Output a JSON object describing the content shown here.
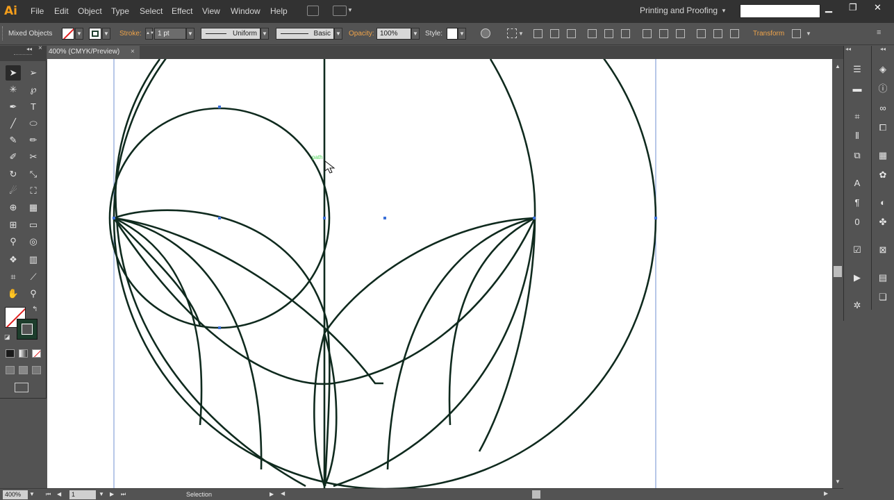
{
  "app": {
    "logo": "Ai"
  },
  "menu": {
    "items": [
      "File",
      "Edit",
      "Object",
      "Type",
      "Select",
      "Effect",
      "View",
      "Window",
      "Help"
    ],
    "workspace": "Printing and Proofing",
    "search_value": ""
  },
  "control_bar": {
    "selection_type": "Mixed Objects",
    "stroke_label": "Stroke:",
    "stroke_weight": "1 pt",
    "profile": "Uniform",
    "brush": "Basic",
    "opacity_label": "Opacity:",
    "opacity": "100%",
    "style_label": "Style:",
    "transform_label": "Transform"
  },
  "document": {
    "tab_title": "400% (CMYK/Preview)",
    "tab_close": "×",
    "hover_hint": "path"
  },
  "status_bar": {
    "zoom": "400%",
    "artboard": "1",
    "tool_name": "Selection"
  },
  "colors": {
    "stroke": "#0f2a1e",
    "selection": "#3a6fd8",
    "guide": "#6f8fd0",
    "fill_none": "#ffffff",
    "stroke_swatch": "#1d3d2c"
  },
  "tools": [
    "selection-tool",
    "direct-selection-tool",
    "magic-wand-tool",
    "lasso-tool",
    "pen-tool",
    "type-tool",
    "line-tool",
    "ellipse-tool",
    "paintbrush-tool",
    "pencil-tool",
    "blob-brush-tool",
    "scissors-tool",
    "rotate-tool",
    "scale-tool",
    "warp-tool",
    "free-transform-tool",
    "shape-builder-tool",
    "perspective-grid-tool",
    "mesh-tool",
    "gradient-tool",
    "eyedropper-tool",
    "blend-tool",
    "symbol-sprayer-tool",
    "column-graph-tool",
    "artboard-tool",
    "slice-tool",
    "hand-tool",
    "zoom-tool"
  ]
}
